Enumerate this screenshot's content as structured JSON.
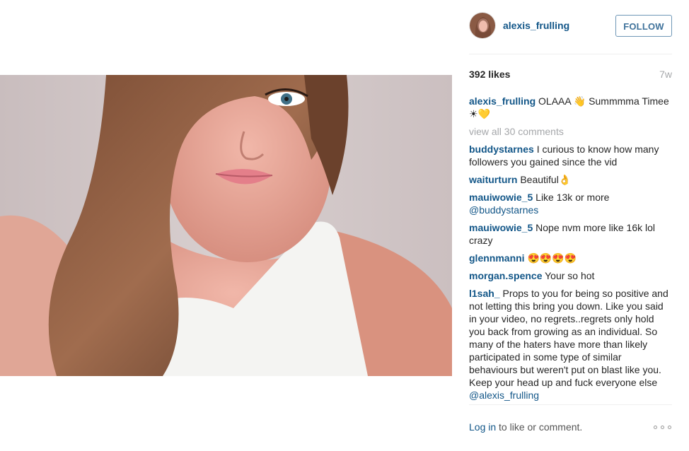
{
  "post": {
    "username": "alexis_frulling",
    "follow_label": "FOLLOW",
    "likes": "392 likes",
    "time": "7w",
    "caption": {
      "user": "alexis_frulling",
      "text": "OLAAA 👋 Summmma Timee☀💛"
    },
    "view_all": "view all 30 comments",
    "comments": [
      {
        "user": "buddystarnes",
        "text": "I curious to know how many followers you gained since the vid"
      },
      {
        "user": "waiturturn",
        "text": "Beautiful👌"
      },
      {
        "user": "mauiwowie_5",
        "text": "Like 13k or more",
        "mention": "@buddystarnes"
      },
      {
        "user": "mauiwowie_5",
        "text": "Nope nvm more like 16k lol crazy"
      },
      {
        "user": "glennmanni",
        "text": "😍😍😍😍"
      },
      {
        "user": "morgan.spence",
        "text": "Your so hot"
      },
      {
        "user": "l1sah_",
        "text": "Props to you for being so positive and not letting this bring you down. Like you said in your video, no regrets..regrets only hold you back from growing as an individual. So many of the haters have more than likely participated in some type of similar behaviours but weren't put on blast like you. Keep your head up and fuck everyone else",
        "mention": "@alexis_frulling"
      }
    ],
    "footer": {
      "login": "Log in",
      "rest": " to like or comment."
    }
  },
  "icons": {
    "more": "more-options-icon"
  },
  "colors": {
    "link": "#125688",
    "follow_border": "#6f97b6",
    "muted": "#a5a7aa"
  }
}
